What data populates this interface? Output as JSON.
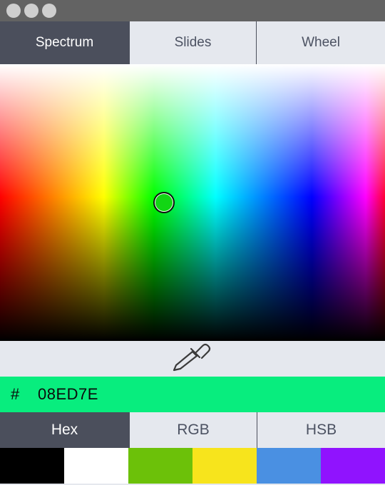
{
  "tabs": [
    {
      "label": "Spectrum",
      "active": true
    },
    {
      "label": "Slides",
      "active": false
    },
    {
      "label": "Wheel",
      "active": false
    }
  ],
  "eyedropper": {
    "icon": "eyedropper-icon"
  },
  "hex": {
    "prefix": "#",
    "value": "08ED7E",
    "color": "#08ed7e"
  },
  "modes": [
    {
      "label": "Hex",
      "active": true
    },
    {
      "label": "RGB",
      "active": false
    },
    {
      "label": "HSB",
      "active": false
    }
  ],
  "swatches": [
    "#000000",
    "#ffffff",
    "#6cc109",
    "#f7e41c",
    "#4a90e2",
    "#9013fe"
  ]
}
